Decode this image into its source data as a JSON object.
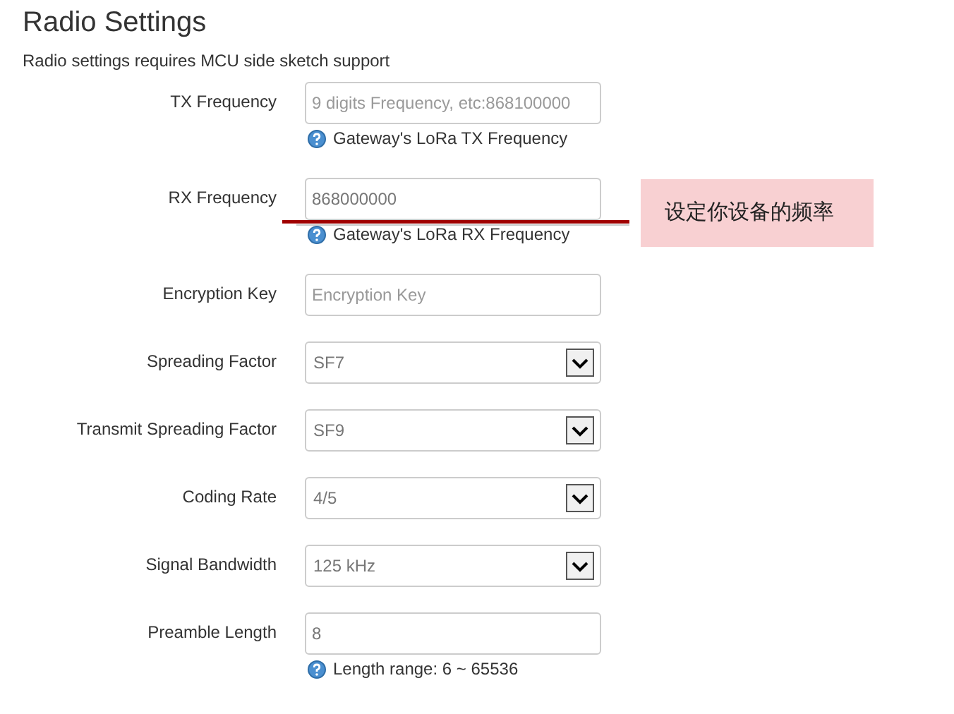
{
  "title": "Radio Settings",
  "description": "Radio settings requires MCU side sketch support",
  "fields": [
    {
      "label": "TX Frequency",
      "kind": "input",
      "placeholder": "9 digits Frequency, etc:868100000",
      "hint": "Gateway's LoRa TX Frequency"
    },
    {
      "label": "RX Frequency",
      "kind": "input",
      "value": "868000000",
      "hint": "Gateway's LoRa RX Frequency"
    },
    {
      "label": "Encryption Key",
      "kind": "input",
      "placeholder": "Encryption Key"
    },
    {
      "label": "Spreading Factor",
      "kind": "select",
      "value": "SF7"
    },
    {
      "label": "Transmit Spreading Factor",
      "kind": "select",
      "value": "SF9"
    },
    {
      "label": "Coding Rate",
      "kind": "select",
      "value": "4/5"
    },
    {
      "label": "Signal Bandwidth",
      "kind": "select",
      "value": "125 kHz"
    },
    {
      "label": "Preamble Length",
      "kind": "input",
      "value": "8",
      "hint": "Length range: 6 ~ 65536"
    }
  ],
  "annotation": {
    "text": "设定你设备的频率"
  }
}
